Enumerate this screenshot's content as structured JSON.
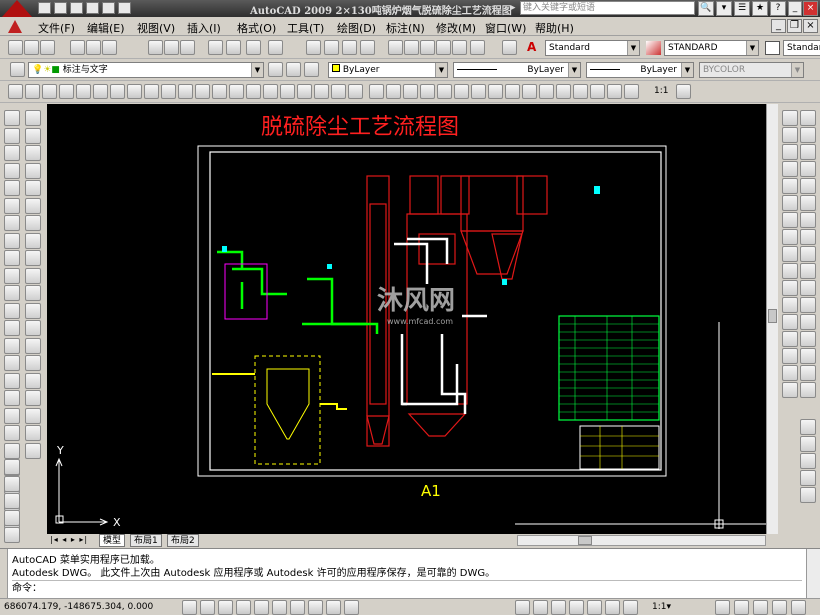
{
  "titlebar": {
    "app": "AutoCAD 2009",
    "doc": "2×130吨锅炉烟气脱硫除尘工艺流程图",
    "search_placeholder": "键入关键字或短语"
  },
  "menu": [
    "文件(F)",
    "编辑(E)",
    "视图(V)",
    "插入(I)",
    "格式(O)",
    "工具(T)",
    "绘图(D)",
    "标注(N)",
    "修改(M)",
    "窗口(W)",
    "帮助(H)"
  ],
  "toolbar": {
    "text_style": "Standard",
    "dim_style": "STANDARD",
    "table_style": "Standar",
    "layer": "标注与文字",
    "color": "ByLayer",
    "linetype": "ByLayer",
    "lineweight": "ByLayer",
    "plotstyle": "BYCOLOR"
  },
  "drawing": {
    "title": "脱硫除尘工艺流程图",
    "sheet_label": "A1",
    "watermark": "沐风网",
    "watermark_url": "www.mfcad.com",
    "axis_x": "X",
    "axis_y": "Y"
  },
  "tabs": [
    "模型",
    "布局1",
    "布局2"
  ],
  "command": {
    "line1": "AutoCAD 菜单实用程序已加载。",
    "line2": "Autodesk DWG。  此文件上次由 Autodesk 应用程序或 Autodesk 许可的应用程序保存，是可靠的 DWG。",
    "prompt": "命令："
  },
  "status": {
    "coords": "686074.179, -148675.304, 0.000",
    "scale": "1:1"
  },
  "colors": {
    "title_red": "#ff2020",
    "frame": "#ffffff",
    "green_pipe": "#00ff00",
    "yellow": "#ffff00",
    "magenta": "#ff00ff",
    "cyan": "#00ffff",
    "table_green": "#00ff40"
  }
}
